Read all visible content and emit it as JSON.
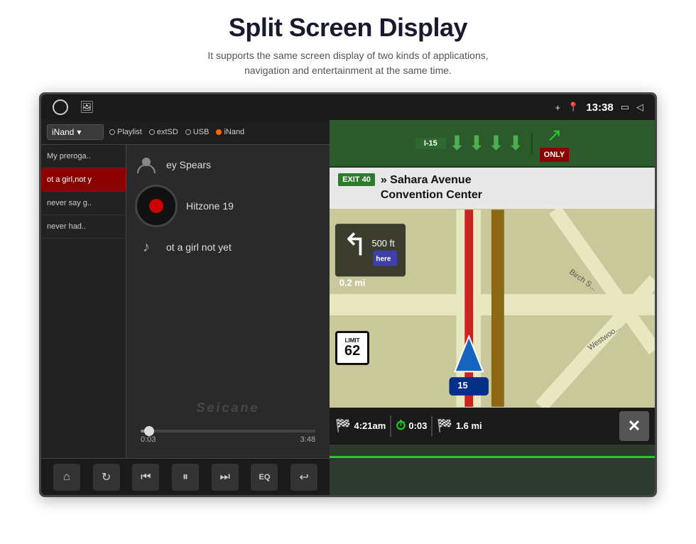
{
  "header": {
    "title": "Split Screen Display",
    "subtitle_line1": "It supports the same screen display of two kinds of applications,",
    "subtitle_line2": "navigation and entertainment at the same time."
  },
  "status_bar": {
    "time": "13:38",
    "bluetooth_icon": "bluetooth",
    "location_icon": "location",
    "window_icon": "window",
    "back_icon": "back"
  },
  "music_player": {
    "source_dropdown": "iNand",
    "sources": [
      "Playlist",
      "extSD",
      "USB",
      "iNand"
    ],
    "playlist_items": [
      {
        "label": "My preroga..",
        "active": false
      },
      {
        "label": "ot a girl,not y",
        "active": true
      },
      {
        "label": "never say g..",
        "active": false
      },
      {
        "label": "never had..",
        "active": false
      }
    ],
    "artist": "ey Spears",
    "album": "Hitzone 19",
    "track": "ot a girl not yet",
    "progress_current": "0:03",
    "progress_total": "3:48",
    "progress_percent": 5,
    "watermark": "Seicane",
    "transport": {
      "home": "⌂",
      "repeat": "↻",
      "prev": "⏮",
      "play_pause": "⏸",
      "next": "⏭",
      "eq": "EQ",
      "back": "↩"
    }
  },
  "navigation": {
    "highway_id": "I-15",
    "exit_number": "EXIT 40",
    "exit_destination": "» Sahara Avenue\nConvention Center",
    "speed_limit": "62",
    "interstate_label": "I-15",
    "interstate_number": "15",
    "distance_to_exit": "0.2 mi",
    "eta_time": "4:21am",
    "duration": "0:03",
    "remaining_distance": "1.6 mi",
    "only_text": "ONLY"
  }
}
